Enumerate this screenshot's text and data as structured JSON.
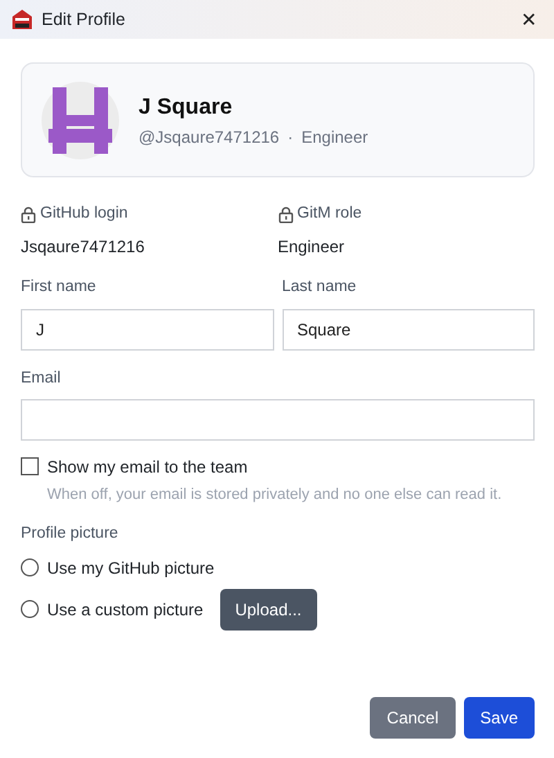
{
  "window": {
    "title": "Edit Profile",
    "close": "✕"
  },
  "profile": {
    "name": "J Square",
    "handle": "@Jsqaure7471216",
    "separator": "·",
    "role": "Engineer"
  },
  "locked_fields": [
    {
      "label": "GitHub login",
      "value": "Jsqaure7471216"
    },
    {
      "label": "GitM role",
      "value": "Engineer"
    }
  ],
  "name_fields": [
    {
      "label": "First name",
      "value": "J"
    },
    {
      "label": "Last name",
      "value": "Square"
    }
  ],
  "email": {
    "label": "Email"
  },
  "show_email": {
    "label": "Show my email to the team",
    "checked": false,
    "hint": "When off, your email is stored privately and no one else can read it."
  },
  "profile_picture": {
    "label": "Profile picture",
    "options": [
      {
        "label": "Use my GitHub picture",
        "selected": false
      },
      {
        "label": "Use a custom picture",
        "selected": false,
        "button": "Upload..."
      }
    ]
  },
  "buttons": [
    {
      "label": "Cancel",
      "kind": "secondary"
    },
    {
      "label": "Save",
      "kind": "primary"
    }
  ]
}
